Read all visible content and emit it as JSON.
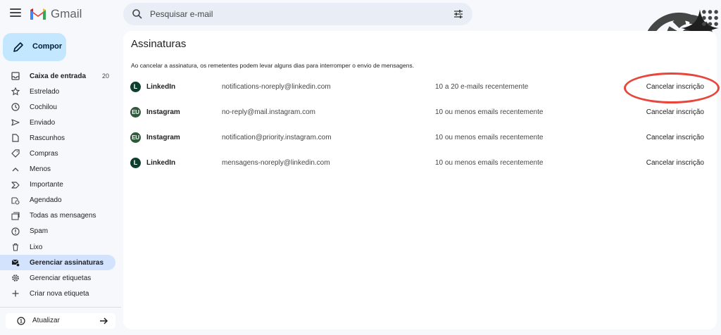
{
  "header": {
    "app_name": "Gmail",
    "search_placeholder": "Pesquisar e-mail"
  },
  "compose": {
    "label": "Compor"
  },
  "sidebar": {
    "items": [
      {
        "label": "Caixa de entrada",
        "count": "20",
        "icon": "inbox-icon"
      },
      {
        "label": "Estrelado",
        "count": "",
        "icon": "star-icon"
      },
      {
        "label": "Cochilou",
        "count": "",
        "icon": "clock-icon"
      },
      {
        "label": "Enviado",
        "count": "",
        "icon": "send-icon"
      },
      {
        "label": "Rascunhos",
        "count": "",
        "icon": "draft-icon"
      },
      {
        "label": "Compras",
        "count": "",
        "icon": "tag-icon"
      },
      {
        "label": "Menos",
        "count": "",
        "icon": "chevron-up-icon"
      },
      {
        "label": "Importante",
        "count": "",
        "icon": "important-icon"
      },
      {
        "label": "Agendado",
        "count": "",
        "icon": "scheduled-icon"
      },
      {
        "label": "Todas as mensagens",
        "count": "",
        "icon": "all-mail-icon"
      },
      {
        "label": "Spam",
        "count": "",
        "icon": "spam-icon"
      },
      {
        "label": "Lixo",
        "count": "",
        "icon": "trash-icon"
      },
      {
        "label": "Gerenciar assinaturas",
        "count": "",
        "icon": "manage-subscriptions-icon"
      },
      {
        "label": "Gerenciar etiquetas",
        "count": "",
        "icon": "gear-icon"
      },
      {
        "label": "Criar nova etiqueta",
        "count": "",
        "icon": "plus-icon"
      }
    ],
    "update_label": "Atualizar"
  },
  "main": {
    "title": "Assinaturas",
    "subtitle": "Ao cancelar a assinatura, os remetentes podem levar alguns dias para interromper o envio de mensagens.",
    "rows": [
      {
        "avatar": "L",
        "sender": "LinkedIn",
        "email": "notifications-noreply@linkedin.com",
        "frequency": "10 a 20 e-mails recentemente",
        "action": "Cancelar inscrição"
      },
      {
        "avatar": "EU",
        "sender": "Instagram",
        "email": "no-reply@mail.instagram.com",
        "frequency": "10 ou menos emails recentemente",
        "action": "Cancelar inscrição"
      },
      {
        "avatar": "EU",
        "sender": "Instagram",
        "email": "notification@priority.instagram.com",
        "frequency": "10 ou menos emails recentemente",
        "action": "Cancelar inscrição"
      },
      {
        "avatar": "L",
        "sender": "LinkedIn",
        "email": "mensagens-noreply@linkedin.com",
        "frequency": "10 ou menos emails recentemente",
        "action": "Cancelar inscrição"
      }
    ]
  },
  "colors": {
    "highlight_circle": "#e8453c",
    "active_nav": "#d3e3fd",
    "compose_bg": "#c2e7ff"
  }
}
